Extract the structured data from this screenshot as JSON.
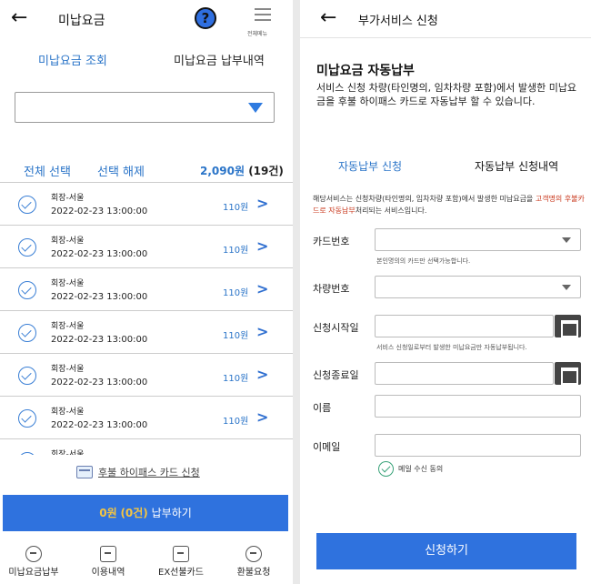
{
  "left": {
    "header": {
      "title": "미납요금",
      "help": "?",
      "menu_label": "전체메뉴"
    },
    "tabs": [
      "미납요금 조회",
      "미납요금 납부내역"
    ],
    "selection": {
      "select_all": "전체 선택",
      "deselect": "선택 해제",
      "total_amount": "2,090원",
      "total_count": "(19건)"
    },
    "items": [
      {
        "route": "회장-서울",
        "datetime": "2022-02-23 13:00:00",
        "fee": "110원"
      },
      {
        "route": "회장-서울",
        "datetime": "2022-02-23 13:00:00",
        "fee": "110원"
      },
      {
        "route": "회장-서울",
        "datetime": "2022-02-23 13:00:00",
        "fee": "110원"
      },
      {
        "route": "회장-서울",
        "datetime": "2022-02-23 13:00:00",
        "fee": "110원"
      },
      {
        "route": "회장-서울",
        "datetime": "2022-02-23 13:00:00",
        "fee": "110원"
      },
      {
        "route": "회장-서울",
        "datetime": "2022-02-23 13:00:00",
        "fee": "110원"
      },
      {
        "route": "회장-서울",
        "datetime": "",
        "fee": ""
      }
    ],
    "card_link": "후불 하이패스 카드 신청",
    "pay": {
      "amount": "0원",
      "count": "(0건)",
      "label": " 납부하기"
    },
    "nav": [
      "미납요금납부",
      "이용내역",
      "EX선불카드",
      "환불요청"
    ]
  },
  "right": {
    "header": {
      "title": "부가서비스 신청"
    },
    "heading": "미납요금 자동납부",
    "description": "서비스 신청 차량(타인명의, 임차차량 포함)에서 발생한 미납요금을 후불 하이패스 카드로 자동납부 할 수 있습니다.",
    "tabs": [
      "자동납부 신청",
      "자동납부 신청내역"
    ],
    "notice": {
      "part1": "해당서비스는 신청차량(타인명의, 임차차량 포함)에서 발생한 미납요금을 ",
      "highlight": "고객명의 후불카드로 자동납부",
      "part2": "처리되는 서비스입니다."
    },
    "form": {
      "card_label": "카드번호",
      "card_hint": "본인명의의 카드만 선택가능합니다.",
      "vehicle_label": "차량번호",
      "start_label": "신청시작일",
      "start_hint": "서비스 신청일로부터 발생한 미납요금만 자동납부됩니다.",
      "end_label": "신청종료일",
      "name_label": "이름",
      "email_label": "이메일",
      "agree_label": "메일 수신 동의"
    },
    "submit": "신청하기"
  }
}
